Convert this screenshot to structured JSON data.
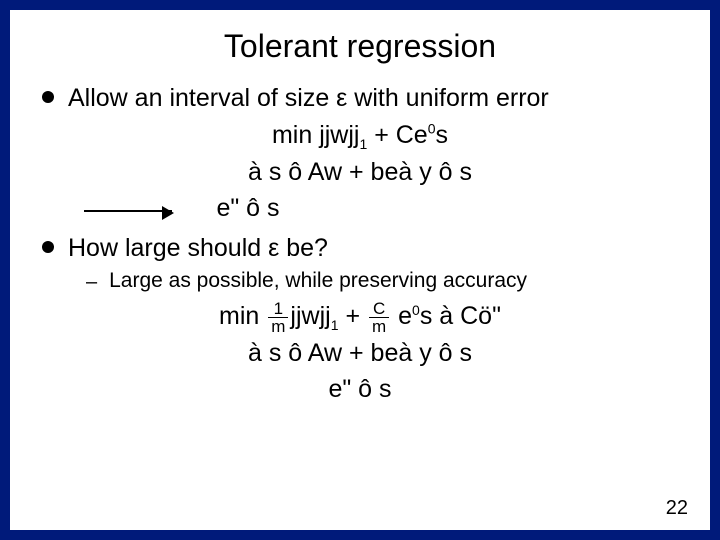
{
  "title": "Tolerant regression",
  "bullets": {
    "b1": "Allow an interval of size ε with uniform error",
    "b2": "How large should ε be?"
  },
  "sub1": "Large as possible, while preserving accuracy",
  "eq1_l1_a": "min jjwjj",
  "eq1_l1_b": " + Ce",
  "eq1_l1_c": "s",
  "eq1_l2": "à s ô Aw + beà y ô s",
  "eq1_l3": "e\" ô s",
  "eq2_pre": "min ",
  "eq2_mid": "jjwjj",
  "eq2_plus": " + ",
  "eq2_tail": " e",
  "eq2_tail2": "s à Cö\"",
  "eq2_l2": "à s ô Aw + beà y ô s",
  "eq2_l3": "e\" ô s",
  "frac1_n": "1",
  "frac1_d": "m",
  "frac2_n": "C",
  "frac2_d": "m",
  "one": "1",
  "zero": "0",
  "pagenum": "22"
}
